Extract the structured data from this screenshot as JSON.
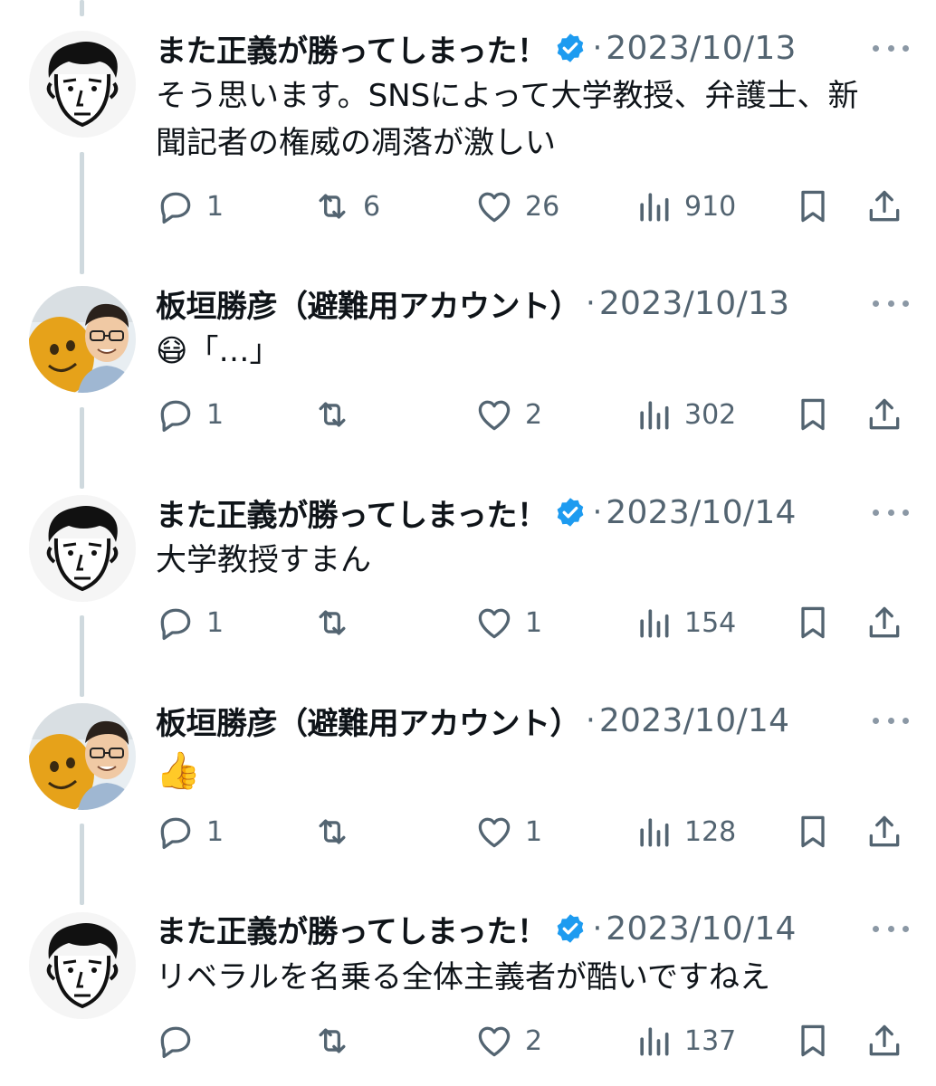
{
  "colors": {
    "text_primary": "#0f1419",
    "text_secondary": "#536471",
    "verified": "#1d9bf0",
    "thread_line": "#cfd9de"
  },
  "tweets": [
    {
      "author": "また正義が勝ってしまった！",
      "verified": true,
      "date": "2023/10/13",
      "separator": "·",
      "text": "そう思います。SNSによって大学教授、弁護士、新聞記者の権威の凋落が激しい",
      "replies": "1",
      "retweets": "6",
      "likes": "26",
      "views": "910",
      "avatar_icon": "cartoon-face-avatar"
    },
    {
      "author": "板垣勝彦（避難用アカウント）",
      "verified": false,
      "date": "2023/10/13",
      "separator": "·",
      "text": "😷「…」",
      "replies": "1",
      "retweets": "",
      "likes": "2",
      "views": "302",
      "avatar_icon": "photo-avatar"
    },
    {
      "author": "また正義が勝ってしまった！",
      "verified": true,
      "date": "2023/10/14",
      "separator": "·",
      "text": "大学教授すまん",
      "replies": "1",
      "retweets": "",
      "likes": "1",
      "views": "154",
      "avatar_icon": "cartoon-face-avatar"
    },
    {
      "author": "板垣勝彦（避難用アカウント）",
      "verified": false,
      "date": "2023/10/14",
      "separator": "·",
      "text": "👍",
      "replies": "1",
      "retweets": "",
      "likes": "1",
      "views": "128",
      "avatar_icon": "photo-avatar"
    },
    {
      "author": "また正義が勝ってしまった！",
      "verified": true,
      "date": "2023/10/14",
      "separator": "·",
      "text": "リベラルを名乗る全体主義者が酷いですねえ",
      "replies": "",
      "retweets": "",
      "likes": "2",
      "views": "137",
      "avatar_icon": "cartoon-face-avatar"
    }
  ]
}
